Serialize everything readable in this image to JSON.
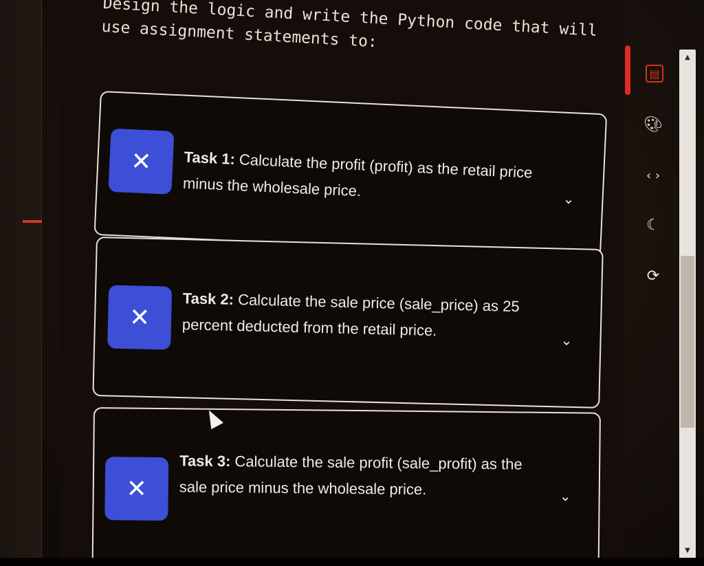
{
  "instructions": {
    "line1": "Design the logic and write the Python code that will",
    "line2": "use assignment statements to:"
  },
  "tasks": [
    {
      "label": "Task 1:",
      "text": " Calculate the profit (profit) as the retail price minus the wholesale price.",
      "status_icon": "close-icon",
      "expand_icon": "chevron-down-icon"
    },
    {
      "label": "Task 2:",
      "text": " Calculate the sale price (sale_price) as 25 percent deducted from the retail price.",
      "status_icon": "close-icon",
      "expand_icon": "chevron-down-icon"
    },
    {
      "label": "Task 3:",
      "text": " Calculate the sale profit (sale_profit) as the sale price minus the wholesale price.",
      "status_icon": "close-icon",
      "expand_icon": "chevron-down-icon"
    }
  ],
  "toolbar": {
    "items": [
      "reader-mode-icon",
      "palette-icon",
      "code-icon",
      "dark-mode-icon",
      "refresh-icon"
    ]
  },
  "colors": {
    "task_status_bg": "#3c4fd6",
    "accent_red": "#e02a25",
    "text": "#f0ebe4",
    "background": "#140d09"
  }
}
